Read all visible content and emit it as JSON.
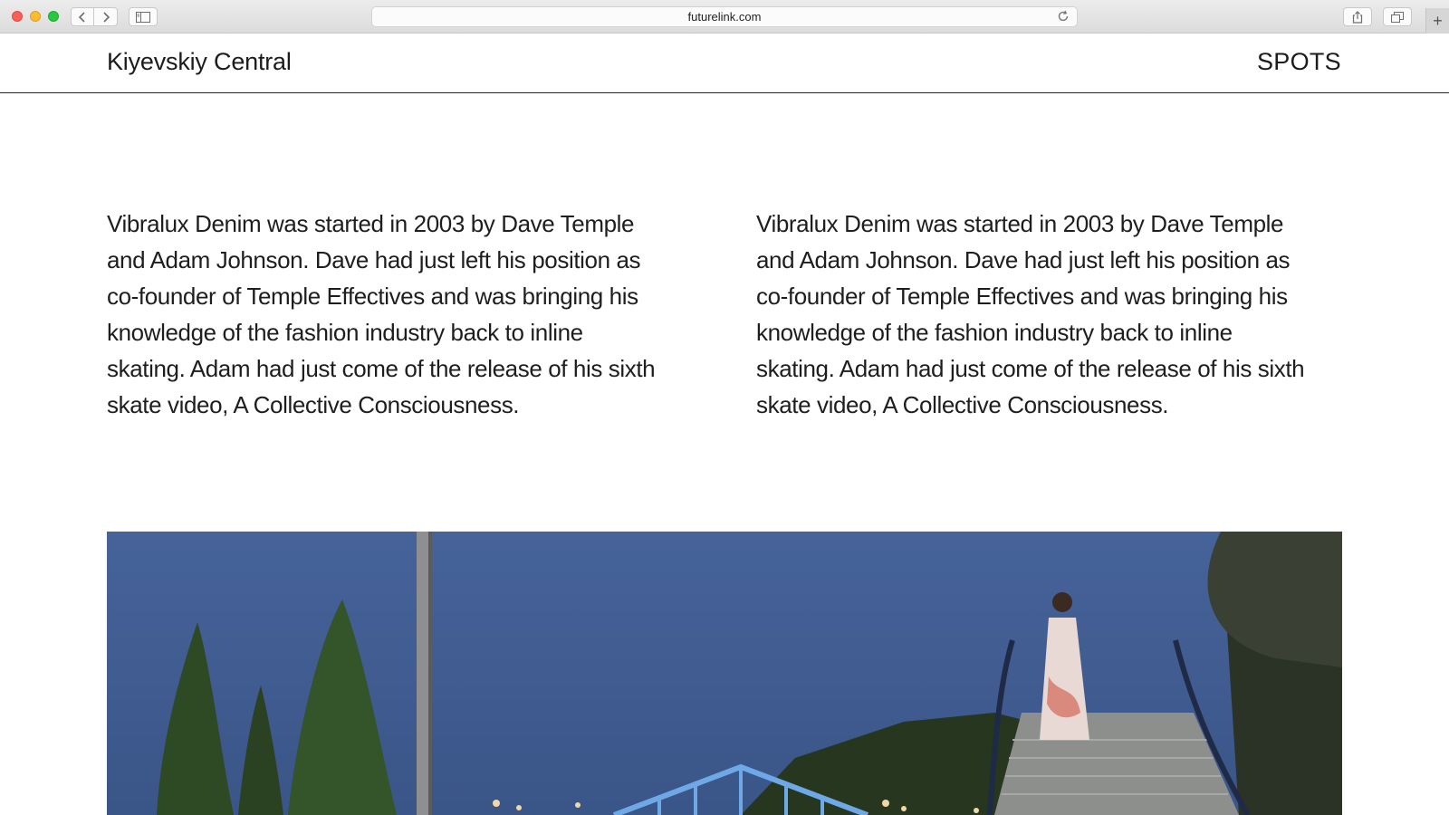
{
  "browser": {
    "url": "futurelink.com",
    "icons": {
      "back": "chevron-left-icon",
      "forward": "chevron-right-icon",
      "sidebar": "sidebar-icon",
      "reload": "reload-icon",
      "share": "share-icon",
      "tabs": "tabs-overview-icon",
      "new_tab": "plus-icon"
    }
  },
  "header": {
    "site_title": "Kiyevskiy Central",
    "nav_label": "SPOTS"
  },
  "content": {
    "column_left": "Vibralux Denim was started in 2003 by Dave Temple\nand Adam Johnson.  Dave had just left his position as\nco-founder of Temple Effectives and was bringing his\nknowledge of the fashion industry back to inline\nskating.  Adam had just come of the release of his sixth\nskate video, A Collective Consciousness.",
    "column_right": "Vibralux Denim was started in 2003 by Dave Temple\nand Adam Johnson.  Dave had just left his position as\nco-founder of Temple Effectives and was bringing his\nknowledge of the fashion industry back to inline\nskating.  Adam had just come of the release of his sixth\nskate video, A Collective Consciousness."
  },
  "colors": {
    "text": "#1e1e1e",
    "sky": "#4a679c",
    "trees": "#2d4a2a"
  }
}
